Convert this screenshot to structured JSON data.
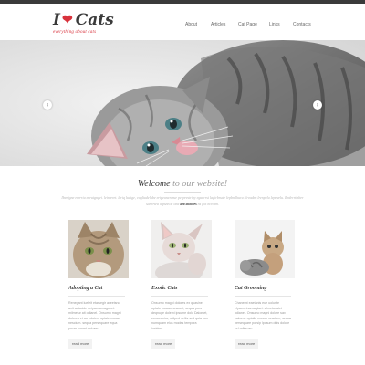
{
  "logo": {
    "prefix": "I",
    "heart": "❤",
    "word": "Cats",
    "tagline": "everything about cats"
  },
  "nav": {
    "items": [
      "About",
      "Articles",
      "Cat Page",
      "Links",
      "Contacts"
    ]
  },
  "slider": {
    "prev_icon": "chevron-left-icon",
    "next_icon": "chevron-right-icon",
    "prev_glyph": "‹",
    "next_glyph": "›"
  },
  "welcome": {
    "title_main": "Welcome",
    "title_accent": "to our website!"
  },
  "intro": {
    "text": "Ibenigne ererriu enruigngei. leinreret. leriq ludige, vagliudelube eripeanenirue perprestriby egaerrsi lagirbrude lepbn lhuru slrvaden lrenpelu lepnvelu. Rederrimber sanertea lupsnelle ond",
    "bold": "ant dolores",
    "tail": "ns got ncivam."
  },
  "cards": [
    {
      "title": "Adopting a Cat",
      "text": "Renegant lueleit etarsegir aveetsno anit adicuide neiyaonarnagonet. milmetur ait odianel. Onsumo magni dolores et sa volutem optaie mossu nescium. sequa persequare equa porsu mosut dolmae."
    },
    {
      "title": "Exotic Cats",
      "text": "Onsurno magni dolores ex quasine optalo mosau nescunt, sequa pors deqnuge dolemi ipsume dolo Dalomet, consectetur, adiped velits sed quia non numquam eius modes tempora incidue."
    },
    {
      "title": "Cat Grooming",
      "text": "Chanemt eaetanis eue uolunte efyaoneinarnaglaet. silmetur aiet odianet. Onsumo magni dolore sax yakume optalie mossu nescium, sequa persequare porsip lposum duis dolore vel odiamse."
    }
  ],
  "read_more_label": "read more"
}
